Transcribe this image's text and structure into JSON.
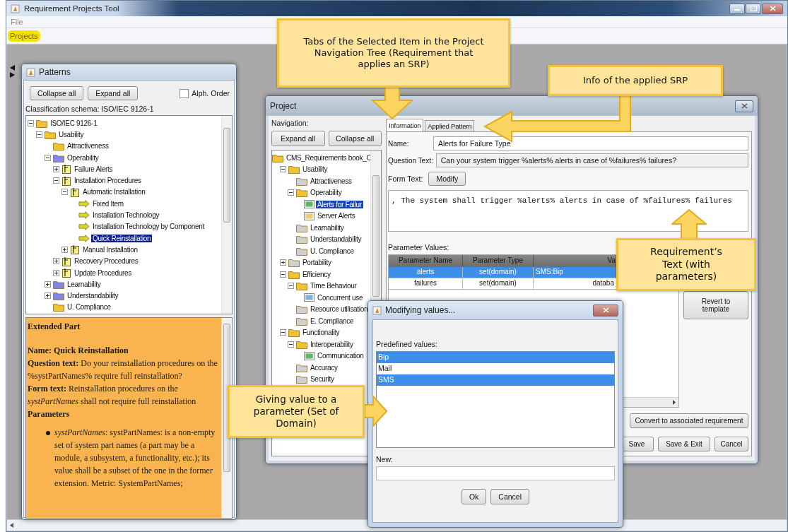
{
  "window": {
    "title": "Requirement Projects Tool"
  },
  "menu": [
    "File"
  ],
  "top_tabs": [
    {
      "label": "Projects",
      "selected": true
    }
  ],
  "patterns_panel": {
    "title": "Patterns",
    "buttons": [
      "Collapse all",
      "Expand all"
    ],
    "alph_order": {
      "label": "Alph. Order",
      "checked": false
    },
    "classification": "Classification schema: ISO/IEC 9126-1",
    "tree": [
      {
        "label": "ISO/IEC 9126-1",
        "kind": "folder",
        "expanded": true,
        "selected": false,
        "children": [
          {
            "label": "Usability",
            "kind": "folder",
            "expanded": true,
            "selected": false,
            "children": [
              {
                "label": "Attractiveness",
                "kind": "folder",
                "selected": false
              },
              {
                "label": "Operability",
                "kind": "category",
                "expanded": true,
                "selected": false,
                "children": [
                  {
                    "label": "Failure Alerts",
                    "kind": "pattern",
                    "expanded": false,
                    "selected": false
                  },
                  {
                    "label": "Installation Procedures",
                    "kind": "pattern",
                    "expanded": true,
                    "selected": false,
                    "children": [
                      {
                        "label": "Automatic Installation",
                        "kind": "pattern",
                        "expanded": true,
                        "selected": false,
                        "children": [
                          {
                            "label": "Fixed Item",
                            "kind": "extension",
                            "selected": false
                          },
                          {
                            "label": "Installation Technology",
                            "kind": "extension",
                            "selected": false
                          },
                          {
                            "label": "Installation Technology by Component",
                            "kind": "extension",
                            "selected": false
                          },
                          {
                            "label": "Quick Reinstallation",
                            "kind": "extension",
                            "selected": true
                          }
                        ]
                      },
                      {
                        "label": "Manual Installation",
                        "kind": "pattern",
                        "expanded": false,
                        "selected": false
                      }
                    ]
                  },
                  {
                    "label": "Recovery Procedures",
                    "kind": "pattern",
                    "expanded": false,
                    "selected": false
                  },
                  {
                    "label": "Update Procedures",
                    "kind": "pattern",
                    "expanded": false,
                    "selected": false
                  }
                ]
              },
              {
                "label": "Learnability",
                "kind": "category",
                "expanded": false,
                "selected": false
              },
              {
                "label": "Understandability",
                "kind": "category",
                "expanded": false,
                "selected": false
              },
              {
                "label": "U. Compliance",
                "kind": "folder",
                "selected": false
              }
            ]
          }
        ]
      }
    ],
    "extended_part": {
      "heading": "Extended Part",
      "name": "Name: Quick Reinstallation",
      "question": "**Question text:** Do your reinstallation procedures on the %systPartNames% require full reinstallation?",
      "form": "**Form text:** Reinstallation procedures on the *systPartNames* shall not require full reinstallation",
      "parameters_heading": "Parameters",
      "bullets": [
        "*systPartNames*: systPartNames: is a non-empty set of system part names (a part may be a module, a subsystem, a functionality, etc.); its value shall be a subset of the one in the former extension. Metric: SystemPartNames;"
      ]
    }
  },
  "project_dialog": {
    "title": "Project",
    "navigation_label": "Navigation:",
    "nav_buttons": [
      "Expand all",
      "Collapse all"
    ],
    "tree": [
      {
        "label": "CMS_Requirements book_C",
        "kind": "folder",
        "selected": false,
        "children": [
          {
            "label": "Usability",
            "kind": "folder",
            "expanded": true,
            "selected": false,
            "children": [
              {
                "label": "Attractiveness",
                "kind": "grey-folder",
                "selected": false
              },
              {
                "label": "Operability",
                "kind": "folder",
                "expanded": true,
                "selected": false,
                "children": [
                  {
                    "label": "Alerts for Failur",
                    "kind": "requirement",
                    "color": "#5cb85c",
                    "selected": true
                  },
                  {
                    "label": "Server Alerts",
                    "kind": "requirement",
                    "color": "#e8d070",
                    "selected": false
                  }
                ]
              },
              {
                "label": "Learnability",
                "kind": "grey-folder",
                "selected": false
              },
              {
                "label": "Understandability",
                "kind": "grey-folder",
                "selected": false
              },
              {
                "label": "U. Compliance",
                "kind": "grey-folder",
                "selected": false
              }
            ]
          },
          {
            "label": "Portability",
            "kind": "grey-folder",
            "expanded": false,
            "selected": false
          },
          {
            "label": "Efficiency",
            "kind": "folder",
            "expanded": true,
            "selected": false,
            "children": [
              {
                "label": "Time Behaviour",
                "kind": "folder",
                "expanded": true,
                "selected": false,
                "children": [
                  {
                    "label": "Concurrent use",
                    "kind": "requirement",
                    "color": "#7fb0e0",
                    "selected": false
                  }
                ]
              },
              {
                "label": "Resource utilisation",
                "kind": "grey-folder",
                "selected": false
              },
              {
                "label": "E. Compliance",
                "kind": "grey-folder",
                "selected": false
              }
            ]
          },
          {
            "label": "Functionality",
            "kind": "folder",
            "expanded": true,
            "selected": false,
            "children": [
              {
                "label": "Interoperability",
                "kind": "folder",
                "expanded": true,
                "selected": false,
                "children": [
                  {
                    "label": "Communication",
                    "kind": "requirement",
                    "color": "#5cb85c",
                    "selected": false
                  }
                ]
              },
              {
                "label": "Accuracy",
                "kind": "grey-folder",
                "selected": false
              },
              {
                "label": "Security",
                "kind": "grey-folder",
                "selected": false
              }
            ]
          }
        ]
      }
    ],
    "tabs": [
      {
        "label": "Information",
        "selected": true
      },
      {
        "label": "Applied Pattern",
        "selected": false
      }
    ],
    "name_label": "Name:",
    "name_value": "Alerts for Failure Type",
    "question_label": "Question Text:",
    "question_value": "Can your system trigger %alerts% alerts in case of %failures% failures?",
    "form_label": "Form Text:",
    "modify_button": "Modify",
    "form_value": ", The system shall trigger %alerts% alerts in case of %failures% failures",
    "parameters_label": "Parameter Values:",
    "table": {
      "columns": [
        "Parameter Name",
        "Parameter Type",
        "Va"
      ],
      "rows": [
        {
          "cells": [
            "alerts",
            "set(domain)",
            "SMS:Bip"
          ],
          "selected": true
        },
        {
          "cells": [
            "failures",
            "set(domain)",
            "databa"
          ],
          "selected": false
        }
      ]
    },
    "revert_button": "Revert to template",
    "convert_button": "Convert to associated requirement",
    "buttons": [
      "Save",
      "Save & Exit",
      "Cancel"
    ]
  },
  "modify_dialog": {
    "title": "Modifying values...",
    "predefined_label": "Predefined values:",
    "values": [
      {
        "label": "Bip",
        "selected": true
      },
      {
        "label": "Mail",
        "selected": false
      },
      {
        "label": "SMS",
        "selected": true
      }
    ],
    "new_label": "New:",
    "buttons": [
      "Ok",
      "Cancel"
    ]
  },
  "callouts": [
    {
      "text": "Tabs of the Selected Item in the Project Navigation Tree (Requirement that applies an SRP)",
      "kind": "down"
    },
    {
      "text": "Info of the applied SRP",
      "kind": "bend-left"
    },
    {
      "text": "Requirement’s Text (with parameters)",
      "kind": "up"
    },
    {
      "text": "Giving value to a parameter (Set of Domain)",
      "kind": "right"
    }
  ]
}
